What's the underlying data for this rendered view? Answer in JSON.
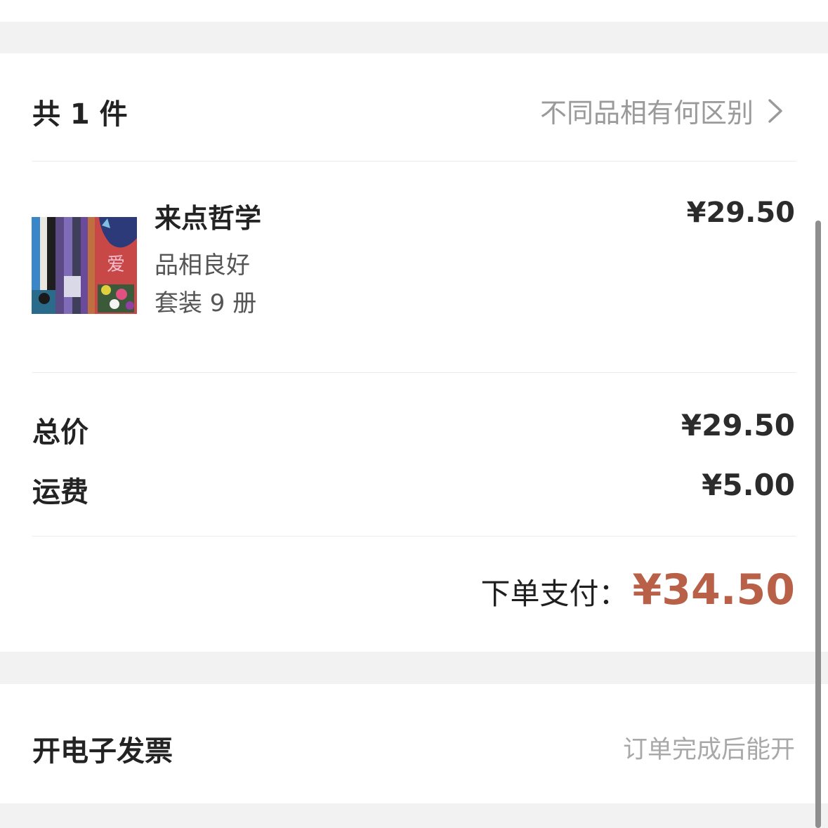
{
  "summary": {
    "item_count": "共 1 件",
    "grade_diff_link": "不同品相有何区别"
  },
  "item": {
    "title": "来点哲学",
    "condition": "品相良好",
    "set": "套装 9 册",
    "price": "¥29.50",
    "cover_text": "爱"
  },
  "totals": {
    "total_label": "总价",
    "total_value": "¥29.50",
    "shipping_label": "运费",
    "shipping_value": "¥5.00",
    "pay_label": "下单支付：",
    "pay_value": "¥34.50"
  },
  "invoice": {
    "label": "开电子发票",
    "note": "订单完成后能开"
  },
  "colors": {
    "accent_price": "#b96148",
    "muted_text": "#9a9a9a",
    "band": "#f2f2f2"
  },
  "icons": {
    "grade_link": "chevron-right-icon"
  }
}
